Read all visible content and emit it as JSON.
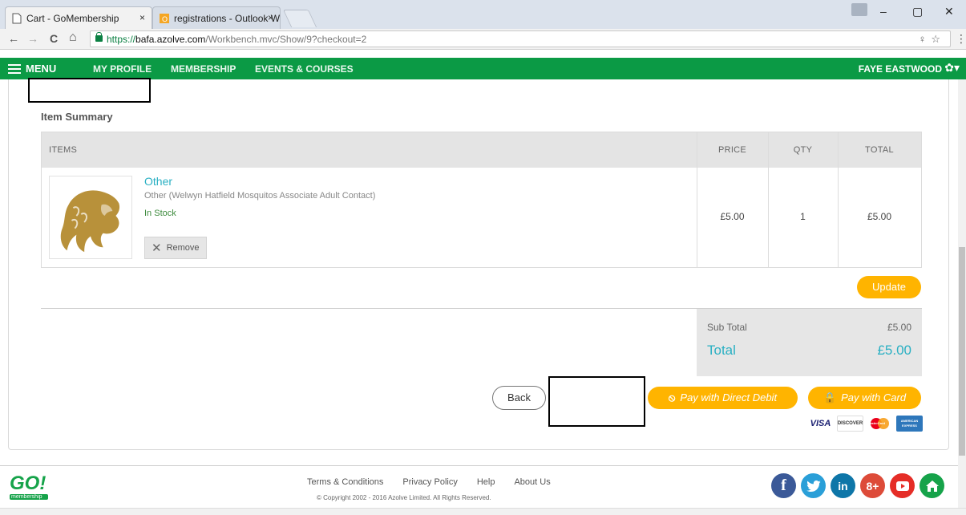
{
  "browser": {
    "tabs": [
      {
        "title": "Cart - GoMembership",
        "close": "×"
      },
      {
        "title": "registrations - Outlook W",
        "close": "×"
      }
    ],
    "url_scheme": "https://",
    "url_host": "bafa.azolve.com",
    "url_path": "/Workbench.mvc/Show/9?checkout=2",
    "nav": {
      "back": "←",
      "forward": "→",
      "reload": "C",
      "home": "⌂"
    },
    "window_controls": {
      "minimize": "–",
      "maximize": "▢",
      "close": "✕"
    },
    "menu_kebab": "⋮",
    "omni_icons": "♀☆"
  },
  "site_nav": {
    "menu_label": "MENU",
    "links": [
      "MY PROFILE",
      "MEMBERSHIP",
      "EVENTS & COURSES"
    ],
    "user_name": "FAYE EASTWOOD",
    "gear": "✿▾"
  },
  "cart": {
    "section_title": "Item Summary",
    "headers": {
      "items": "ITEMS",
      "price": "PRICE",
      "qty": "QTY",
      "total": "TOTAL"
    },
    "item": {
      "name": "Other",
      "description": "Other (Welwyn Hatfield Mosquitos Associate Adult Contact)",
      "stock": "In Stock",
      "remove_label": "Remove",
      "price": "£5.00",
      "qty": "1",
      "total": "£5.00"
    },
    "update_label": "Update",
    "sub_total_label": "Sub Total",
    "sub_total_value": "£5.00",
    "total_label": "Total",
    "total_value": "£5.00",
    "back_label": "Back",
    "pay_direct_debit_label": "Pay with Direct Debit",
    "pay_card_label": "Pay with Card",
    "card_logos": [
      "VISA",
      "DISCOVER",
      "MasterCard",
      "AMERICAN EXPRESS"
    ]
  },
  "footer": {
    "links": [
      "Terms & Conditions",
      "Privacy Policy",
      "Help",
      "About Us"
    ],
    "copyright": "© Copyright 2002 - 2016 Azolve Limited. All Rights Reserved.",
    "logo_text": "GO!",
    "logo_sub": "membership",
    "social": [
      "facebook-icon",
      "twitter-icon",
      "linkedin-icon",
      "googleplus-icon",
      "youtube-icon",
      "home-icon"
    ]
  },
  "colors": {
    "nav_green": "#0b9a45",
    "accent_teal": "#2ab0c3",
    "button_amber": "#ffb400"
  }
}
